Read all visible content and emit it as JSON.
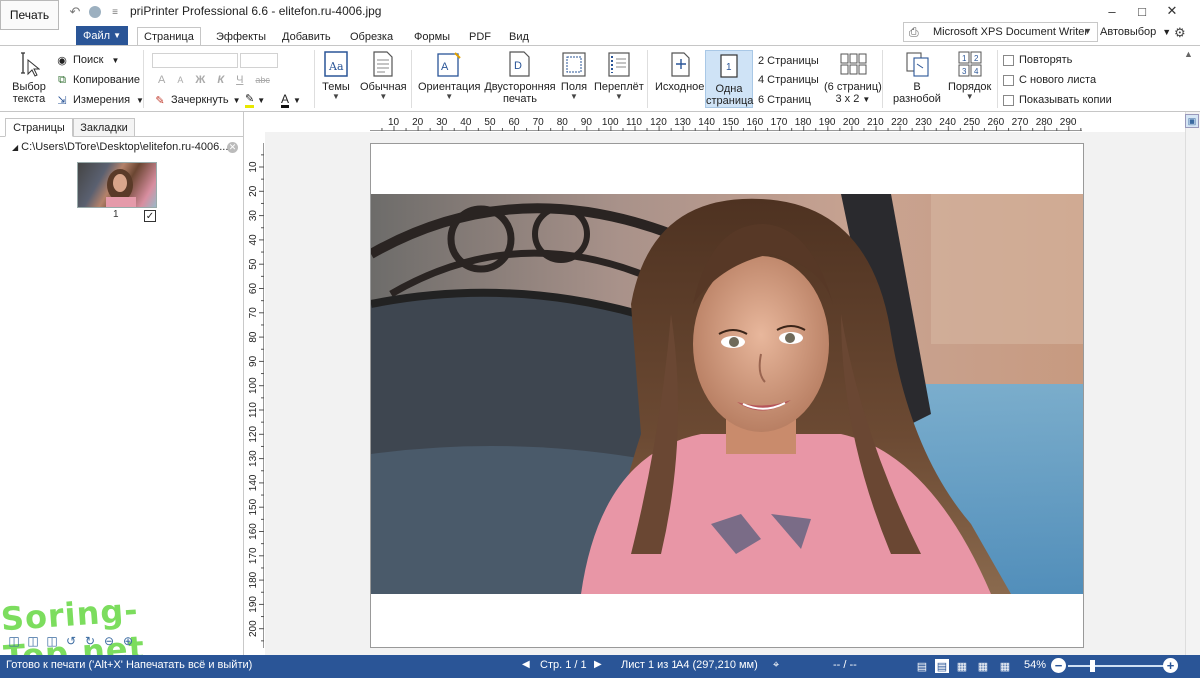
{
  "titlebar": {
    "print_button": "Печать",
    "title": "priPrinter Professional 6.6 - elitefon.ru-4006.jpg",
    "quick_access": [
      "undo-icon",
      "circle-icon",
      "customize-icon"
    ],
    "controls": [
      "minimize",
      "maximize",
      "close"
    ]
  },
  "tabs": {
    "file": "Файл",
    "items": [
      "Страница",
      "Эффекты",
      "Добавить",
      "Обрезка",
      "Формы",
      "PDF",
      "Вид"
    ],
    "active": "Страница"
  },
  "printer": {
    "name": "Microsoft XPS Document Writer",
    "auto_select": "Автовыбор"
  },
  "ribbon": {
    "select_text": "Выбор текста",
    "search": "Поиск",
    "copy": "Копирование",
    "measure": "Измерения",
    "strike": "Зачеркнуть",
    "format_glyphs": [
      "A",
      "A",
      "Ж",
      "К",
      "Ч",
      "abc"
    ],
    "themes": "Темы",
    "normal": "Обычная",
    "orientation": "Ориентация",
    "duplex": "Двусторонняя печать",
    "margins": "Поля",
    "binding": "Переплёт",
    "original": "Исходное",
    "one_page": "Одна страница",
    "two_pages": "2 Страницы",
    "four_pages": "4 Страницы",
    "six_pages": "6 Страниц",
    "six_grid_top": "(6 страниц)",
    "six_grid_bottom": "3 x 2",
    "scatter": "В разнобой",
    "order": "Порядок",
    "repeat": "Повторять",
    "new_sheet": "С нового листа",
    "show_copies": "Показывать копии"
  },
  "left_panel": {
    "tab_pages": "Страницы",
    "tab_bookmarks": "Закладки",
    "file_path": "C:\\Users\\DTore\\Desktop\\elitefon.ru-4006....",
    "thumb_number": "1",
    "watermark": "Soring-Top.net"
  },
  "rulers": {
    "horizontal": [
      "10",
      "20",
      "30",
      "40",
      "50",
      "60",
      "70",
      "80",
      "90",
      "100",
      "110",
      "120",
      "130",
      "140",
      "150",
      "160",
      "170",
      "180",
      "190",
      "200",
      "210",
      "220",
      "230",
      "240",
      "250",
      "260",
      "270",
      "280",
      "290"
    ],
    "vertical": [
      "10",
      "20",
      "30",
      "40",
      "50",
      "60",
      "70",
      "80",
      "90",
      "100",
      "110",
      "120",
      "130",
      "140",
      "150",
      "160",
      "170",
      "180",
      "190",
      "200",
      "210"
    ]
  },
  "status": {
    "message": "Готово к печати ('Alt+X' Напечатать всё и выйти)",
    "page": "Стр. 1 / 1",
    "sheet": "Лист 1 из 1",
    "paper": "A4 (297,210 мм)",
    "dash": "-- / --",
    "zoom": "54%"
  },
  "colors": {
    "accent": "#2a5597",
    "one_page_highlight": "#cfe3f6"
  }
}
